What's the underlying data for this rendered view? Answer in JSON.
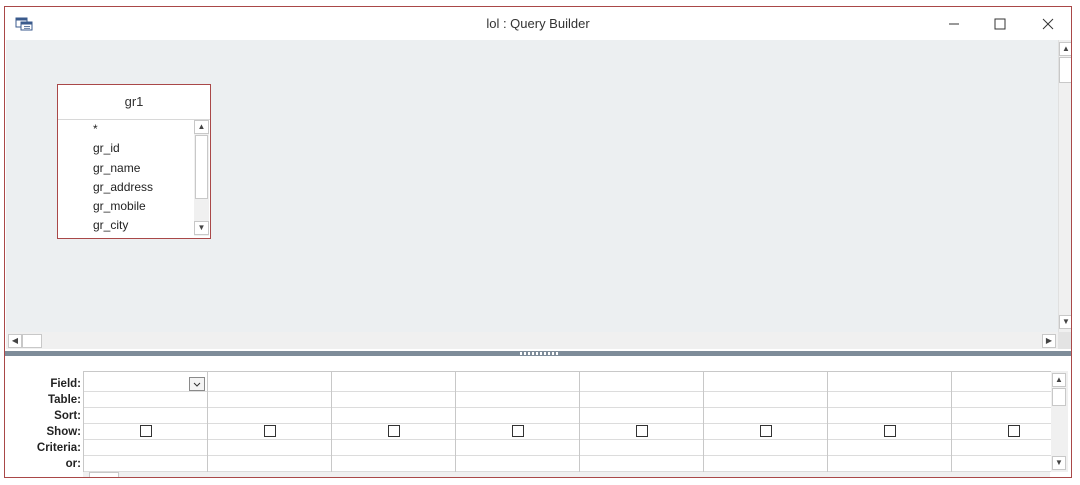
{
  "window": {
    "title": "lol : Query Builder",
    "border_color": "#a94848",
    "design_bg": "#eceff1",
    "splitter_color": "#7e8c99"
  },
  "icons": {
    "app": "query-builder-icon",
    "minimize": "minimize-icon",
    "maximize": "maximize-icon",
    "close": "close-icon"
  },
  "table": {
    "name": "gr1",
    "fields": [
      "*",
      "gr_id",
      "gr_name",
      "gr_address",
      "gr_mobile",
      "gr_city"
    ]
  },
  "grid": {
    "row_labels": [
      "Field:",
      "Table:",
      "Sort:",
      "Show:",
      "Criteria:",
      "or:"
    ],
    "column_count": 8,
    "show_checked": [
      false,
      false,
      false,
      false,
      false,
      false,
      false,
      false
    ]
  }
}
